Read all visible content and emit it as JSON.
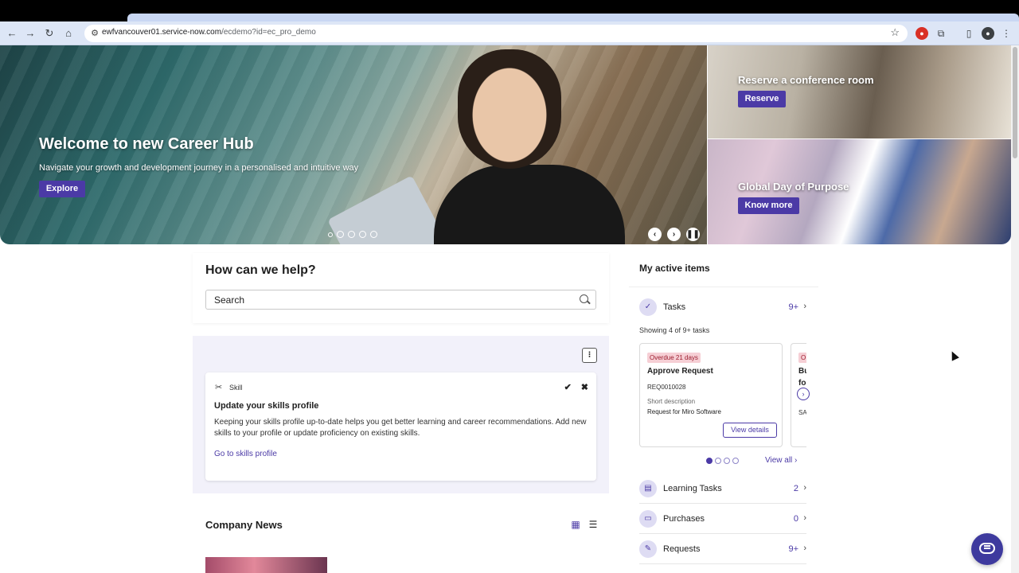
{
  "browser": {
    "url_host": "ewfvancouver01.service-now.com",
    "url_path": "/ecdemo?id=ec_pro_demo",
    "nav_icons": [
      "back-icon",
      "forward-icon",
      "reload-icon",
      "home-icon"
    ],
    "toolbar_icons": [
      "bookmark-star-icon",
      "extension-icon",
      "puzzle-icon",
      "side-panel-icon",
      "profile-icon",
      "menu-icon"
    ]
  },
  "hero": {
    "title": "Welcome to new Career Hub",
    "subtitle": "Navigate your growth and development journey in a personalised and intuitive way",
    "button": "Explore",
    "slides": 5,
    "active_slide": 4,
    "controls": [
      "previous-icon",
      "next-icon",
      "pause-icon"
    ]
  },
  "promos": [
    {
      "title": "Reserve a conference room",
      "button": "Reserve"
    },
    {
      "title": "Global Day of Purpose",
      "button": "Know more"
    }
  ],
  "help": {
    "title": "How can we help?",
    "search_placeholder": "Search"
  },
  "todo": {
    "more_label": "⁝",
    "skill_card": {
      "kind": "Skill",
      "title": "Update your skills profile",
      "text": "Keeping your skills profile up-to-date helps you get better learning and career recommendations. Add new skills to your profile or update proficiency on existing skills.",
      "link": "Go to skills profile"
    }
  },
  "news": {
    "title": "Company News"
  },
  "active_items": {
    "title": "My active items",
    "tasks": {
      "label": "Tasks",
      "count": "9+"
    },
    "showing": "Showing 4 of 9+ tasks",
    "task_card": {
      "badge": "Overdue 21 days",
      "title": "Approve Request",
      "number": "REQ0010028",
      "desc_label": "Short description",
      "desc": "Request for Miro Software",
      "button": "View details"
    },
    "peek_card": {
      "badge": "O",
      "title_line1": "Bu",
      "title_line2": "fo",
      "number": "SA"
    },
    "pager": {
      "pages": 4,
      "active": 1
    },
    "view_all": "View all",
    "rows": [
      {
        "label": "Learning Tasks",
        "count": "2",
        "icon": "book-icon"
      },
      {
        "label": "Purchases",
        "count": "0",
        "icon": "cart-icon"
      },
      {
        "label": "Requests",
        "count": "9+",
        "icon": "edit-icon"
      }
    ]
  },
  "colors": {
    "brand": "#4b3aa6",
    "overdue_bg": "#f6cfd5",
    "overdue_text": "#9b1c2e",
    "panel_bg": "#f2f1fa"
  }
}
